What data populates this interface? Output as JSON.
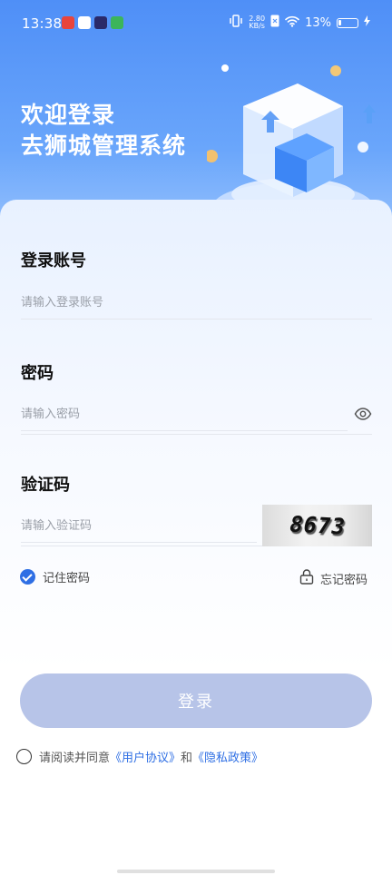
{
  "status_bar": {
    "time": "13:38",
    "net_speed_value": "2.80",
    "net_speed_unit": "KB/s",
    "battery": "13%"
  },
  "header": {
    "title_line1": "欢迎登录",
    "title_line2": "去狮城管理系统"
  },
  "form": {
    "account_label": "登录账号",
    "account_placeholder": "请输入登录账号",
    "password_label": "密码",
    "password_placeholder": "请输入密码",
    "captcha_label": "验证码",
    "captcha_placeholder": "请输入验证码",
    "captcha_text": "8673",
    "remember_label": "记住密码",
    "forgot_label": "忘记密码",
    "login_button": "登录"
  },
  "agreement": {
    "prefix": "请阅读并同意",
    "user_agreement": "《用户协议》",
    "and": "和",
    "privacy_policy": "《隐私政策》"
  },
  "colors": {
    "accent": "#2f6fe4",
    "login_button_bg": "#b7c4e8",
    "hero_gradient_top": "#4f8ff7"
  }
}
